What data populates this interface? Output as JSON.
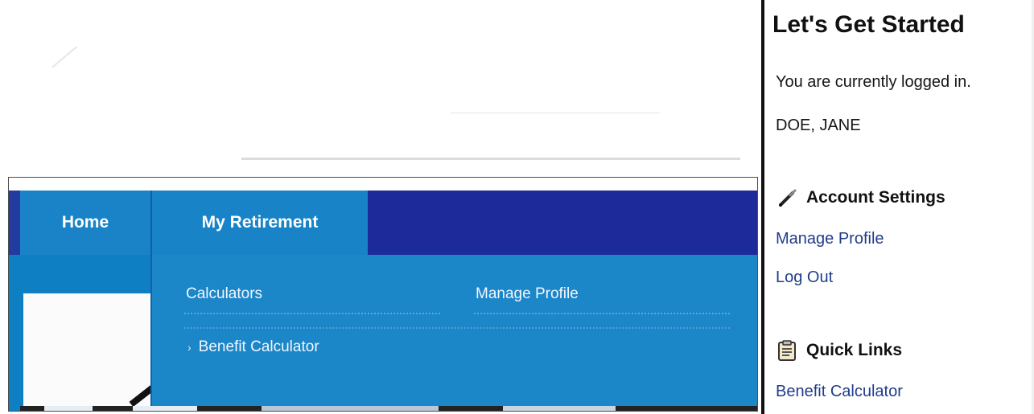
{
  "nav": {
    "items": [
      {
        "label": "Home"
      },
      {
        "label": "My Retirement"
      }
    ]
  },
  "dropdown": {
    "col1_heading": "Calculators",
    "col2_heading": "Manage Profile",
    "col1_links": [
      {
        "label": "Benefit Calculator",
        "icon": "chevron-right-icon"
      }
    ]
  },
  "sidebar": {
    "title": "Let's Get Started",
    "status_text": "You are currently logged in.",
    "user_name": "DOE, JANE",
    "account_settings": {
      "heading": "Account Settings",
      "icon": "pen-icon",
      "links": [
        "Manage Profile",
        "Log Out"
      ]
    },
    "quick_links": {
      "heading": "Quick Links",
      "icon": "clipboard-icon",
      "links": [
        "Benefit Calculator"
      ]
    }
  },
  "colors": {
    "nav_bar": "#1c2a9a",
    "nav_item": "#1a83c7",
    "dropdown": "#1b86c8",
    "link": "#1f3d8a"
  }
}
